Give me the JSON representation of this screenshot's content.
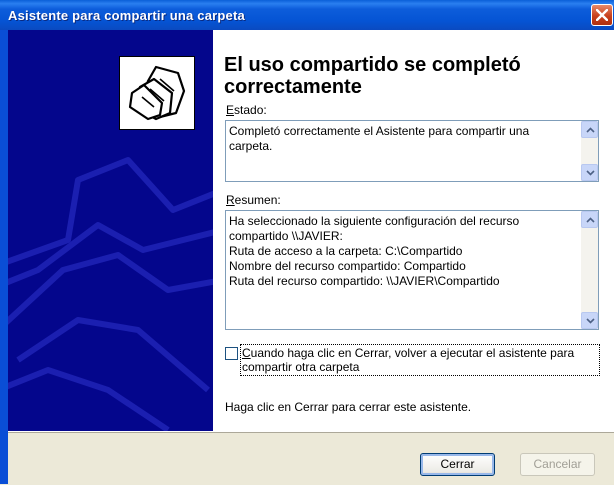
{
  "window": {
    "title": "Asistente para compartir una carpeta"
  },
  "main": {
    "heading": "El uso compartido se completó correctamente",
    "estado_label": "Estado:",
    "estado_hotkey": "E",
    "estado_rest": "stado:",
    "estado_text": "Completó correctamente el Asistente para compartir una carpeta.",
    "resumen_hotkey": "R",
    "resumen_rest": "esumen:",
    "resumen_text": "Ha seleccionado la siguiente configuración del recurso compartido \\\\JAVIER:\nRuta de acceso a la carpeta: C:\\Compartido\nNombre del recurso compartido: Compartido\nRuta del recurso compartido: \\\\JAVIER\\Compartido",
    "checkbox_hotkey": "C",
    "checkbox_rest": "uando haga clic en Cerrar, volver a ejecutar el asistente para compartir otra carpeta",
    "checkbox_checked": false,
    "footer": "Haga clic en Cerrar para cerrar este asistente."
  },
  "buttons": {
    "close": "Cerrar",
    "cancel": "Cancelar"
  },
  "icons": {
    "wizard": "shared-folders-icon",
    "close": "close-icon"
  },
  "colors": {
    "titlebar": "#0554d4",
    "side_panel": "#04068c",
    "close_button": "#c8401c"
  }
}
